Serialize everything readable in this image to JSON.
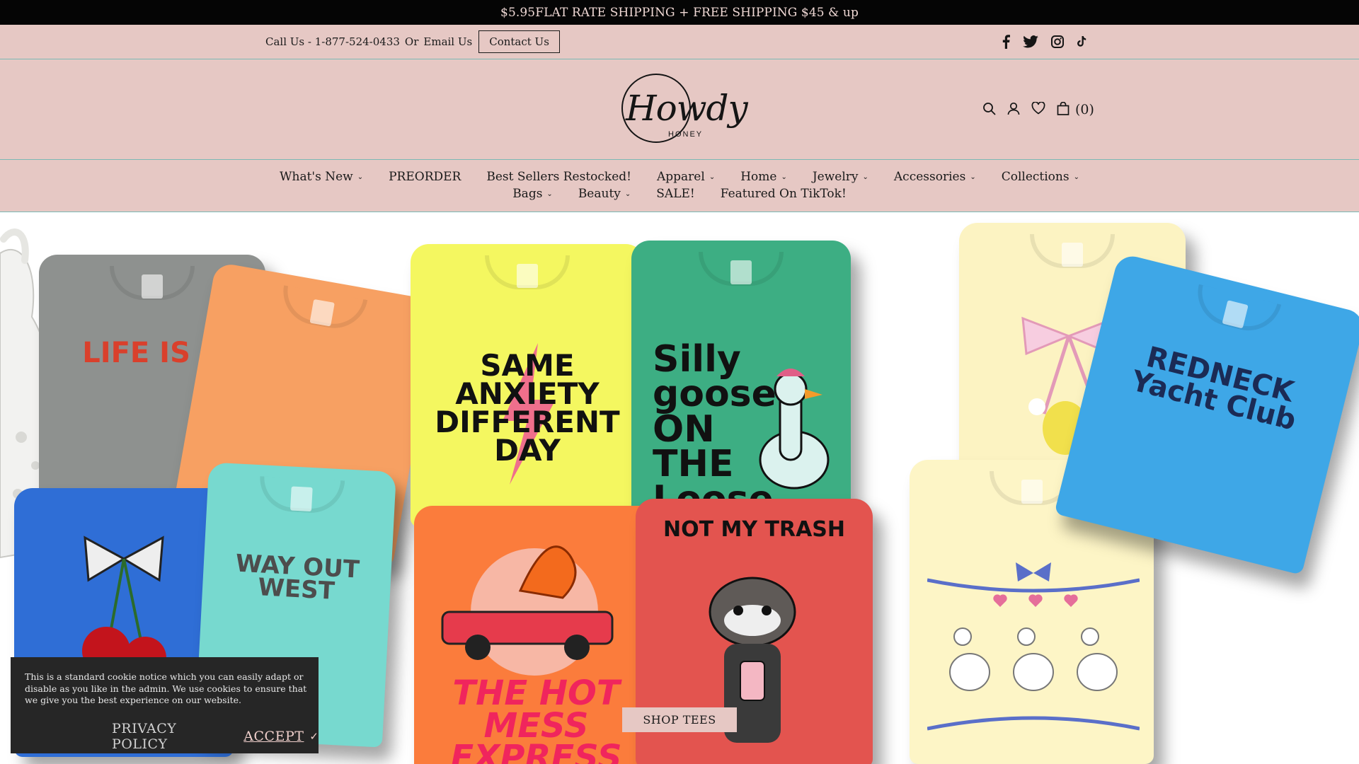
{
  "announcement": {
    "text": "$5.95FLAT RATE SHIPPING + FREE SHIPPING $45 & up"
  },
  "utility": {
    "call_text": "Call Us - 1-877-524-0433",
    "or_text": "Or",
    "email_text": "Email Us",
    "contact_button": "Contact Us",
    "social_icons": [
      "facebook-icon",
      "twitter-icon",
      "instagram-icon",
      "tiktok-icon"
    ]
  },
  "header": {
    "logo_script": "Howdy",
    "logo_sub": "HONEY",
    "icons": [
      "search-icon",
      "account-icon",
      "wishlist-heart-icon",
      "cart-bag-icon"
    ],
    "cart_count": "(0)"
  },
  "nav": {
    "row1": [
      {
        "label": "What's New",
        "dropdown": true
      },
      {
        "label": "PREORDER",
        "dropdown": false
      },
      {
        "label": "Best Sellers Restocked!",
        "dropdown": false
      },
      {
        "label": "Apparel",
        "dropdown": true
      },
      {
        "label": "Home",
        "dropdown": true
      },
      {
        "label": "Jewelry",
        "dropdown": true
      },
      {
        "label": "Accessories",
        "dropdown": true
      },
      {
        "label": "Collections",
        "dropdown": true
      }
    ],
    "row2": [
      {
        "label": "Bags",
        "dropdown": true
      },
      {
        "label": "Beauty",
        "dropdown": true
      },
      {
        "label": "SALE!",
        "dropdown": false
      },
      {
        "label": "Featured On TikTok!",
        "dropdown": false
      }
    ]
  },
  "hero": {
    "cta": "SHOP TEES",
    "shirt_graphics": [
      "LIFE IS A",
      "SAME ANXIETY DIFFERENT DAY",
      "Silly goose ON THE Loose",
      "REDNECK Yacht Club",
      "WAY OUT WEST",
      "THE HOT MESS EXPRESS",
      "NOT MY TRASH"
    ]
  },
  "cookie": {
    "message": "This is a standard cookie notice which you can easily adapt or disable as you like in the admin. We use cookies to ensure that we give you the best experience on our website.",
    "privacy": "PRIVACY POLICY",
    "accept": "ACCEPT",
    "check": "✓"
  },
  "colors": {
    "announce_bg": "#050505",
    "header_bg": "#e6c8c4",
    "divider": "#7bb8b4",
    "cookie_bg": "#262626"
  }
}
